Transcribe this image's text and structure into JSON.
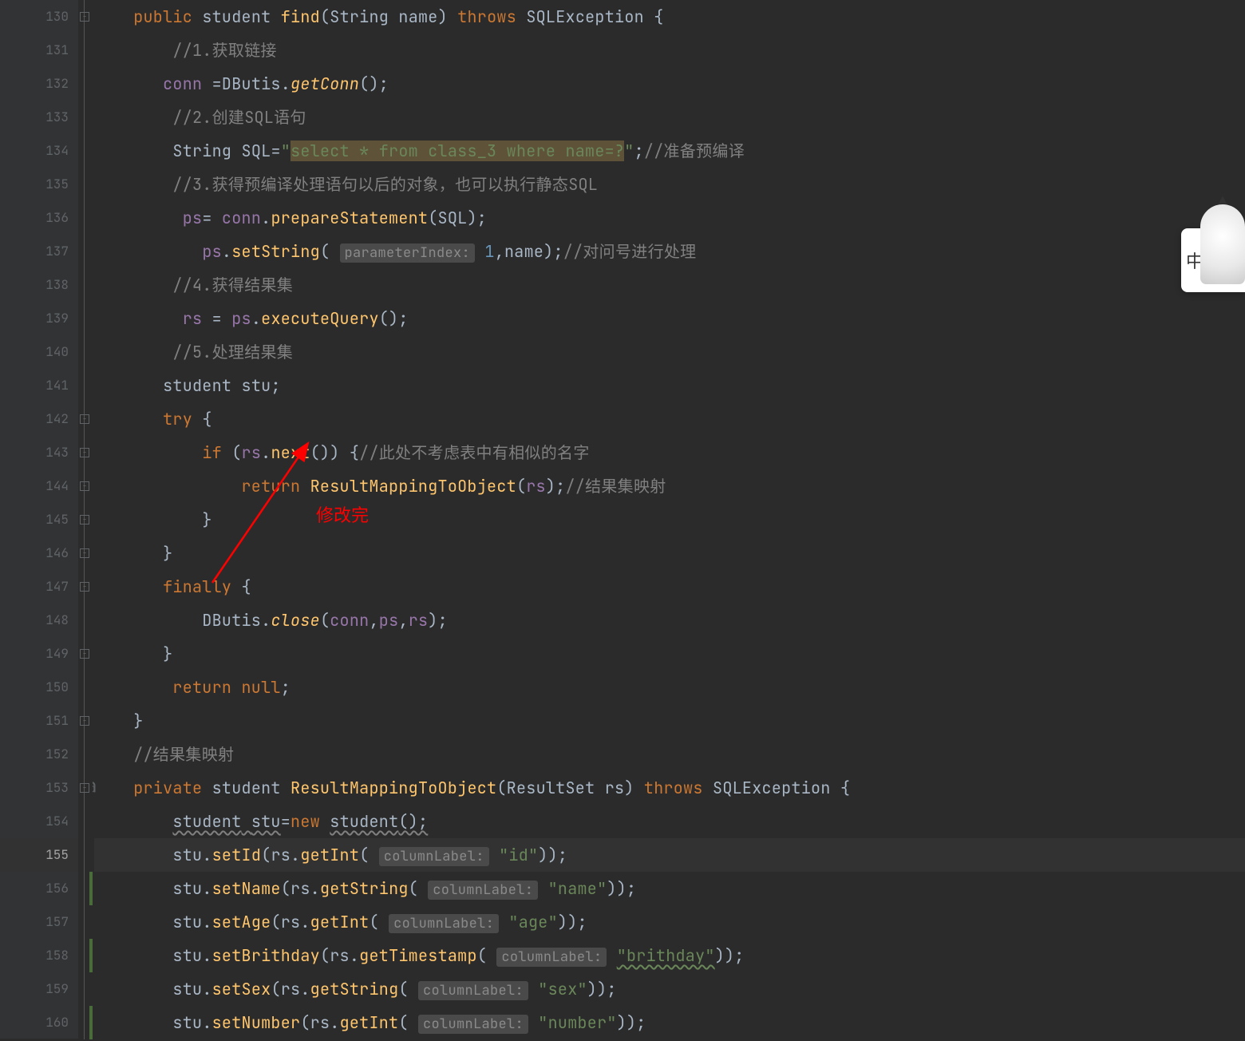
{
  "gutter": {
    "start": 130,
    "end": 160,
    "current": 155,
    "override_at": 153,
    "override_symbol": "@"
  },
  "ime": {
    "char": "中"
  },
  "annotation": {
    "text": "修改完"
  },
  "code": {
    "l130": {
      "indent": "    ",
      "kw1": "public",
      "sp1": " ",
      "type": "student",
      "sp2": " ",
      "method": "find",
      "paren_open": "(",
      "param_type": "String",
      "sp3": " ",
      "param": "name",
      "paren_close": ") ",
      "kw2": "throws",
      "sp4": " ",
      "exc": "SQLException",
      "brace": " {"
    },
    "l131": {
      "indent": "        ",
      "comment": "//1.获取链接"
    },
    "l132": {
      "indent": "       ",
      "field": "conn",
      "sp1": " =",
      "cls": "DButis",
      "dot": ".",
      "method": "getConn",
      "rest": "();"
    },
    "l133": {
      "indent": "        ",
      "comment": "//2.创建SQL语句"
    },
    "l134": {
      "indent": "        ",
      "type": "String",
      "sp": " ",
      "var": "SQL",
      "eq": "=",
      "q1": "\"",
      "str": "select * from class_3 where name=?",
      "q2": "\"",
      "semi": ";",
      "comment": "//准备预编译"
    },
    "l135": {
      "indent": "        ",
      "comment": "//3.获得预编译处理语句以后的对象，也可以执行静态SQL"
    },
    "l136": {
      "indent": "         ",
      "field": "ps",
      "eq": "= ",
      "field2": "conn",
      "dot": ".",
      "method": "prepareStatement",
      "rest": "(SQL);"
    },
    "l137": {
      "indent": "           ",
      "field": "ps",
      "dot": ".",
      "method": "setString",
      "open": "( ",
      "hint": "parameterIndex:",
      "sp": " ",
      "num": "1",
      "rest": ",name);",
      "comment": "//对问号进行处理"
    },
    "l138": {
      "indent": "        ",
      "comment": "//4.获得结果集"
    },
    "l139": {
      "indent": "         ",
      "field": "rs",
      "eq": " = ",
      "field2": "ps",
      "dot": ".",
      "method": "executeQuery",
      "rest": "();"
    },
    "l140": {
      "indent": "        ",
      "comment": "//5.处理结果集"
    },
    "l141": {
      "indent": "       ",
      "type": "student",
      "sp": " ",
      "var": "stu",
      "semi": ";"
    },
    "l142": {
      "indent": "       ",
      "kw": "try",
      "brace": " {"
    },
    "l143": {
      "indent": "           ",
      "kw": "if",
      "sp": " (",
      "field": "rs",
      "dot": ".",
      "method": "next",
      "rest": "()) {",
      "comment": "//此处不考虑表中有相似的名字"
    },
    "l144": {
      "indent": "               ",
      "kw": "return",
      "sp": " ",
      "method": "ResultMappingToObject",
      "open": "(",
      "field": "rs",
      "close": ");",
      "comment": "//结果集映射"
    },
    "l145": {
      "indent": "           ",
      "brace": "}"
    },
    "l146": {
      "indent": "       ",
      "brace": "}"
    },
    "l147": {
      "indent": "       ",
      "kw": "finally",
      "brace": " {"
    },
    "l148": {
      "indent": "           ",
      "cls": "DButis",
      "dot": ".",
      "method": "close",
      "open": "(",
      "a1": "conn",
      "c1": ",",
      "a2": "ps",
      "c2": ",",
      "a3": "rs",
      "close": ");"
    },
    "l149": {
      "indent": "       ",
      "brace": "}"
    },
    "l150": {
      "indent": "        ",
      "kw": "return null",
      "semi": ";"
    },
    "l151": {
      "indent": "    ",
      "brace": "}"
    },
    "l152": {
      "indent": "    ",
      "comment": "//结果集映射"
    },
    "l153": {
      "indent": "    ",
      "kw1": "private",
      "sp1": " ",
      "type": "student",
      "sp2": " ",
      "method": "ResultMappingToObject",
      "open": "(",
      "ptype": "ResultSet",
      "sp3": " ",
      "param": "rs",
      "close": ") ",
      "kw2": "throws",
      "sp4": " ",
      "exc": "SQLException",
      "brace": " {"
    },
    "l154": {
      "indent": "        ",
      "type": "student",
      "sp": " ",
      "var": "stu",
      "eq": "=",
      "kw": "new",
      "sp2": " ",
      "ctor": "student",
      "rest": "();"
    },
    "l155": {
      "indent": "        ",
      "var": "stu",
      "dot": ".",
      "method": "setId",
      "open": "(",
      "p": "rs",
      "dot2": ".",
      "method2": "getInt",
      "open2": "( ",
      "hint": "columnLabel:",
      "sp": " ",
      "str": "\"id\"",
      "close": "));"
    },
    "l156": {
      "indent": "        ",
      "var": "stu",
      "dot": ".",
      "method": "setName",
      "open": "(",
      "p": "rs",
      "dot2": ".",
      "method2": "getString",
      "open2": "( ",
      "hint": "columnLabel:",
      "sp": " ",
      "str": "\"name\"",
      "close": "));"
    },
    "l157": {
      "indent": "        ",
      "var": "stu",
      "dot": ".",
      "method": "setAge",
      "open": "(",
      "p": "rs",
      "dot2": ".",
      "method2": "getInt",
      "open2": "( ",
      "hint": "columnLabel:",
      "sp": " ",
      "str": "\"age\"",
      "close": "));"
    },
    "l158": {
      "indent": "        ",
      "var": "stu",
      "dot": ".",
      "method": "setBrithday",
      "open": "(",
      "p": "rs",
      "dot2": ".",
      "method2": "getTimestamp",
      "open2": "( ",
      "hint": "columnLabel:",
      "sp": " ",
      "str": "\"brithday\"",
      "close": "));"
    },
    "l159": {
      "indent": "        ",
      "var": "stu",
      "dot": ".",
      "method": "setSex",
      "open": "(",
      "p": "rs",
      "dot2": ".",
      "method2": "getString",
      "open2": "( ",
      "hint": "columnLabel:",
      "sp": " ",
      "str": "\"sex\"",
      "close": "));"
    },
    "l160": {
      "indent": "        ",
      "var": "stu",
      "dot": ".",
      "method": "setNumber",
      "open": "(",
      "p": "rs",
      "dot2": ".",
      "method2": "getInt",
      "open2": "( ",
      "hint": "columnLabel:",
      "sp": " ",
      "str": "\"number\"",
      "close": "));"
    }
  }
}
